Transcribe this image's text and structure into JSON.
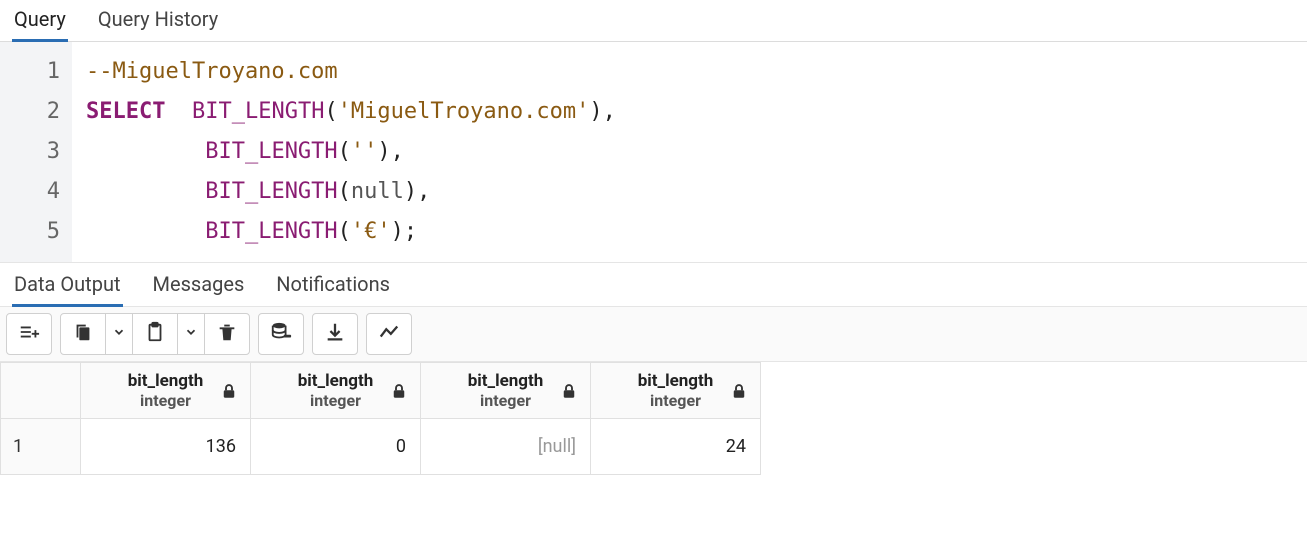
{
  "tabs": {
    "query": "Query",
    "history": "Query History"
  },
  "editor": {
    "line_numbers": [
      "1",
      "2",
      "3",
      "4",
      "5"
    ],
    "l1_comment": "--MiguelTroyano.com",
    "l2_select": "SELECT",
    "l2_func": "BIT_LENGTH",
    "l2_p1": "(",
    "l2_str": "'MiguelTroyano.com'",
    "l2_p2": "),",
    "l3_func": "BIT_LENGTH",
    "l3_p1": "(",
    "l3_str": "''",
    "l3_p2": "),",
    "l4_func": "BIT_LENGTH",
    "l4_p1": "(",
    "l4_null": "null",
    "l4_p2": "),",
    "l5_func": "BIT_LENGTH",
    "l5_p1": "(",
    "l5_str": "'€'",
    "l5_p2": ");",
    "indent_lead": "         ",
    "indent_tail": "  "
  },
  "result_tabs": {
    "data": "Data Output",
    "messages": "Messages",
    "notifications": "Notifications"
  },
  "table": {
    "columns": [
      {
        "name": "bit_length",
        "type": "integer"
      },
      {
        "name": "bit_length",
        "type": "integer"
      },
      {
        "name": "bit_length",
        "type": "integer"
      },
      {
        "name": "bit_length",
        "type": "integer"
      }
    ],
    "rownum": "1",
    "row": [
      {
        "value": "136",
        "null": false
      },
      {
        "value": "0",
        "null": false
      },
      {
        "value": "[null]",
        "null": true
      },
      {
        "value": "24",
        "null": false
      }
    ]
  }
}
